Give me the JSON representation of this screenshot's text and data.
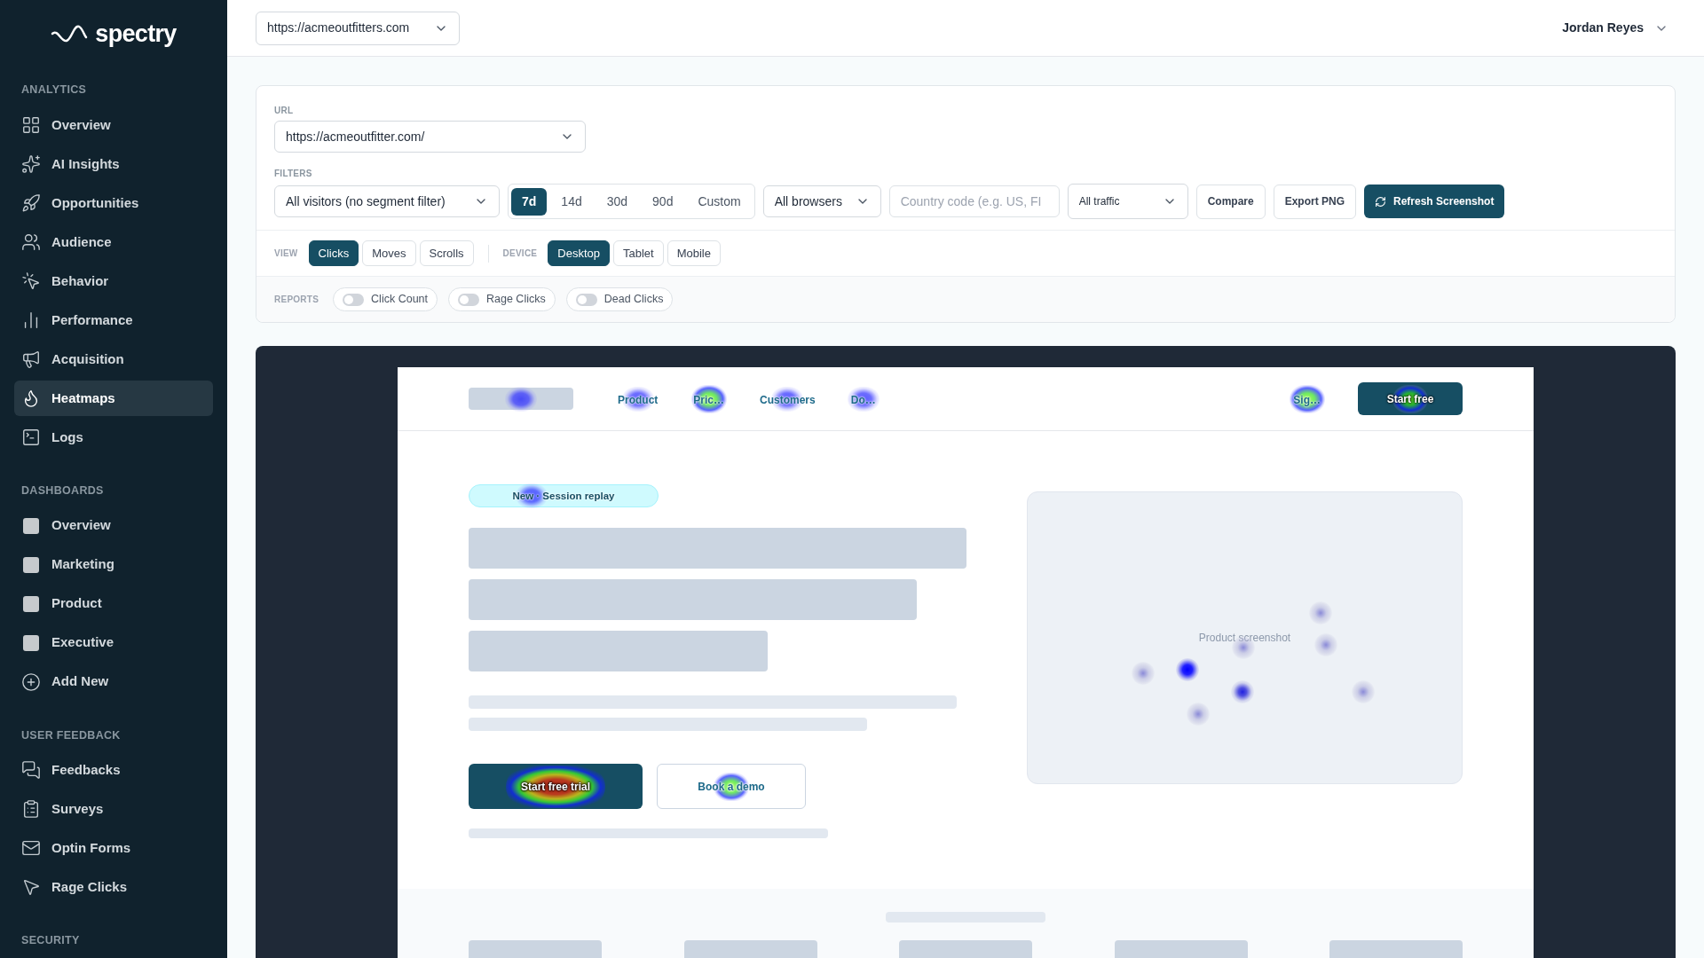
{
  "brand": "spectry",
  "sidebar": {
    "sections": [
      {
        "title": "ANALYTICS",
        "items": [
          {
            "label": "Overview",
            "selected": false
          },
          {
            "label": "AI Insights",
            "selected": false
          },
          {
            "label": "Opportunities",
            "selected": false
          },
          {
            "label": "Audience",
            "selected": false
          },
          {
            "label": "Behavior",
            "selected": false
          },
          {
            "label": "Performance",
            "selected": false
          },
          {
            "label": "Acquisition",
            "selected": false
          },
          {
            "label": "Heatmaps",
            "selected": true
          },
          {
            "label": "Logs",
            "selected": false
          }
        ]
      },
      {
        "title": "DASHBOARDS",
        "items": [
          {
            "label": "Overview",
            "selected": false
          },
          {
            "label": "Marketing",
            "selected": false
          },
          {
            "label": "Product",
            "selected": false
          },
          {
            "label": "Executive",
            "selected": false
          },
          {
            "label": "Add New",
            "selected": false
          }
        ]
      },
      {
        "title": "USER FEEDBACK",
        "items": [
          {
            "label": "Feedbacks",
            "selected": false
          },
          {
            "label": "Surveys",
            "selected": false
          },
          {
            "label": "Optin Forms",
            "selected": false
          },
          {
            "label": "Rage Clicks",
            "selected": false
          }
        ]
      },
      {
        "title": "SECURITY"
      }
    ]
  },
  "header": {
    "site": "https://acmeoutfitters.com",
    "user": "Jordan Reyes"
  },
  "controls": {
    "url_label": "URL",
    "url": "https://acmeoutfitter.com/",
    "filters_label": "FILTERS",
    "segment": "All visitors (no segment filter)",
    "ranges": [
      {
        "label": "7d",
        "selected": true
      },
      {
        "label": "14d",
        "selected": false
      },
      {
        "label": "30d",
        "selected": false
      },
      {
        "label": "90d",
        "selected": false
      },
      {
        "label": "Custom",
        "selected": false
      }
    ],
    "browser": "All browsers",
    "country": {
      "placeholder": "Country code (e.g. US, FI"
    },
    "traffic": "All traffic",
    "buttons": [
      "Compare",
      "Export PNG"
    ],
    "refresh": "Refresh Screenshot",
    "view_label": "VIEW",
    "views": [
      {
        "label": "Clicks",
        "selected": true
      },
      {
        "label": "Moves",
        "selected": false
      },
      {
        "label": "Scrolls",
        "selected": false
      }
    ],
    "device_label": "DEVICE",
    "devices": [
      {
        "label": "Desktop",
        "selected": true
      },
      {
        "label": "Tablet",
        "selected": false
      },
      {
        "label": "Mobile",
        "selected": false
      }
    ],
    "reports_label": "REPORTS",
    "reports": [
      {
        "label": "Click Count",
        "on": false
      },
      {
        "label": "Rage Clicks",
        "on": false
      },
      {
        "label": "Dead Clicks",
        "on": false
      }
    ]
  },
  "preview": {
    "logo": {
      "kind": "cool"
    },
    "nav": [
      {
        "label": "Product",
        "kind": "cool"
      },
      {
        "label": "Pric…",
        "kind": "warm"
      },
      {
        "label": "Customers",
        "kind": "cool"
      },
      {
        "label": "Do…",
        "kind": "cool"
      }
    ],
    "sign": {
      "label": "Sig…",
      "kind": "warm"
    },
    "start": {
      "label": "Start free",
      "kind": "warm"
    },
    "badge": {
      "label": "New · Session replay",
      "kind": "cool"
    },
    "cta_primary": {
      "label": "Start free trial",
      "kind": "hot"
    },
    "cta_secondary": {
      "label": "Book a demo",
      "kind": "warm"
    },
    "screenshot_label": "Product screenshot"
  }
}
